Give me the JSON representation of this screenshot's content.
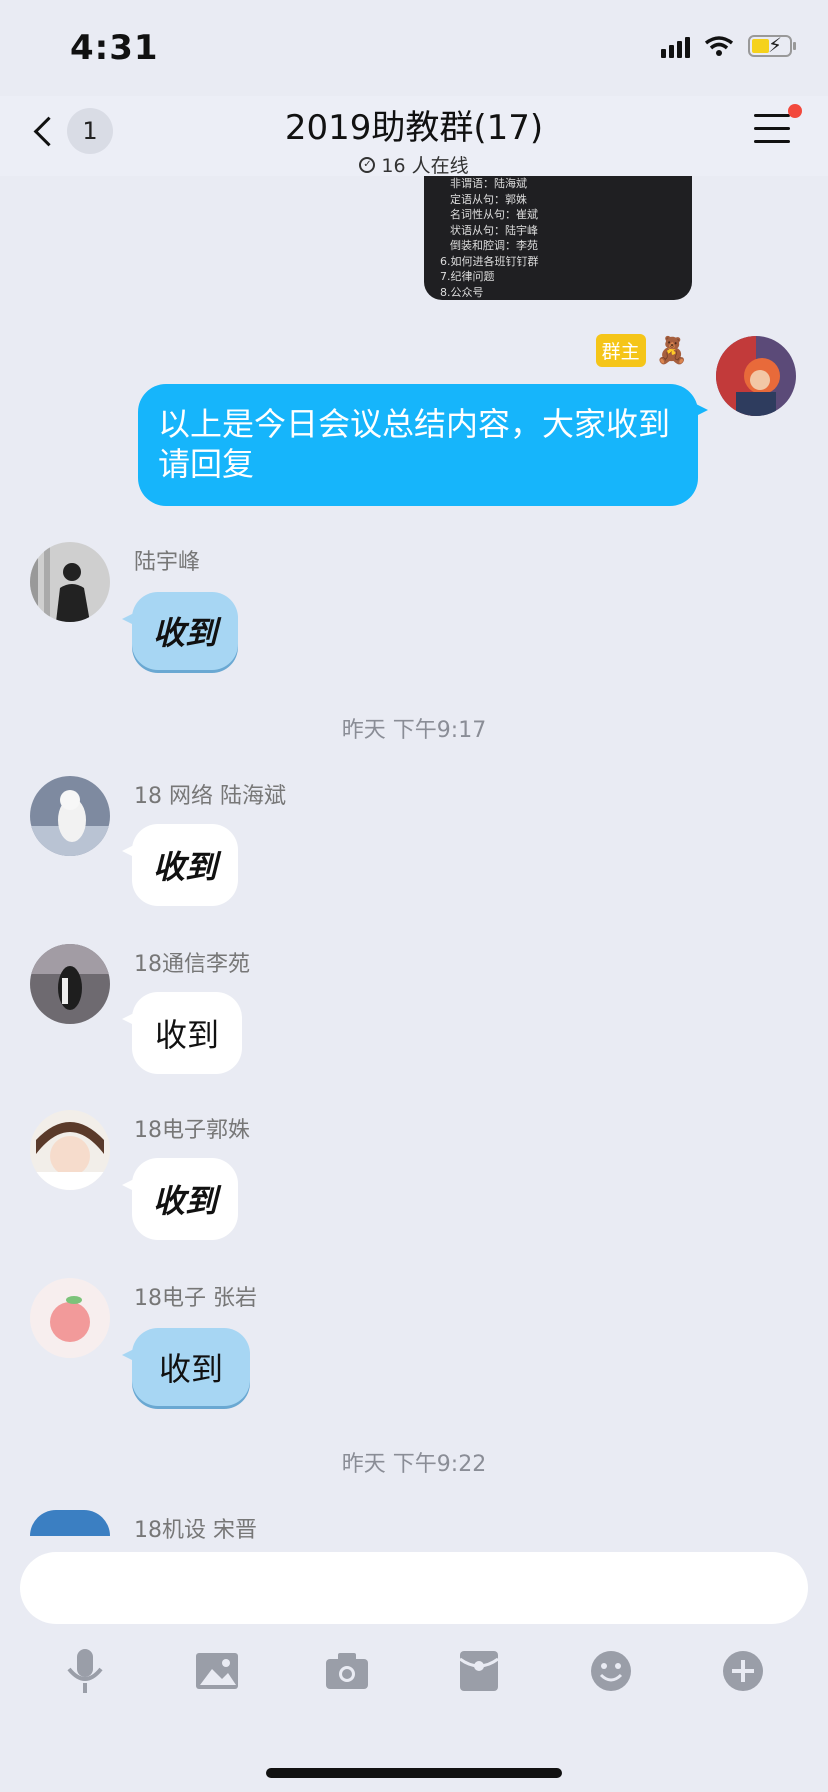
{
  "status": {
    "time": "4:31"
  },
  "header": {
    "back_count": "1",
    "title": "2019助教群(17)",
    "subtitle": "16 人在线"
  },
  "image_message": {
    "lines": [
      "非谓语：陆海斌",
      "定语从句：郭姝",
      "名词性从句：崔斌",
      "状语从句：陆宇峰",
      "倒装和腔调：李苑",
      "6.如何进各班钉钉群",
      "7.纪律问题",
      "8.公众号"
    ]
  },
  "owner_message": {
    "tag": "群主",
    "text": "以上是今日会议总结内容，大家收到请回复"
  },
  "messages": [
    {
      "name": "陆宇峰",
      "text": "收到"
    },
    {
      "name": "18 网络  陆海斌",
      "text": "收到"
    },
    {
      "name": "18通信李苑",
      "text": "收到"
    },
    {
      "name": "18电子郭姝",
      "text": "收到"
    },
    {
      "name": "18电子 张岩",
      "text": "收到"
    },
    {
      "name": "18机设 宋晋",
      "text": ""
    }
  ],
  "timestamps": [
    "昨天 下午9:17",
    "昨天 下午9:22"
  ],
  "toolbar": {
    "icons": [
      "microphone-icon",
      "image-icon",
      "camera-icon",
      "red-packet-icon",
      "emoji-icon",
      "plus-icon"
    ]
  },
  "colors": {
    "accent": "#16b5fb",
    "owner_tag": "#f5c518",
    "background": "#e9ebf3"
  }
}
